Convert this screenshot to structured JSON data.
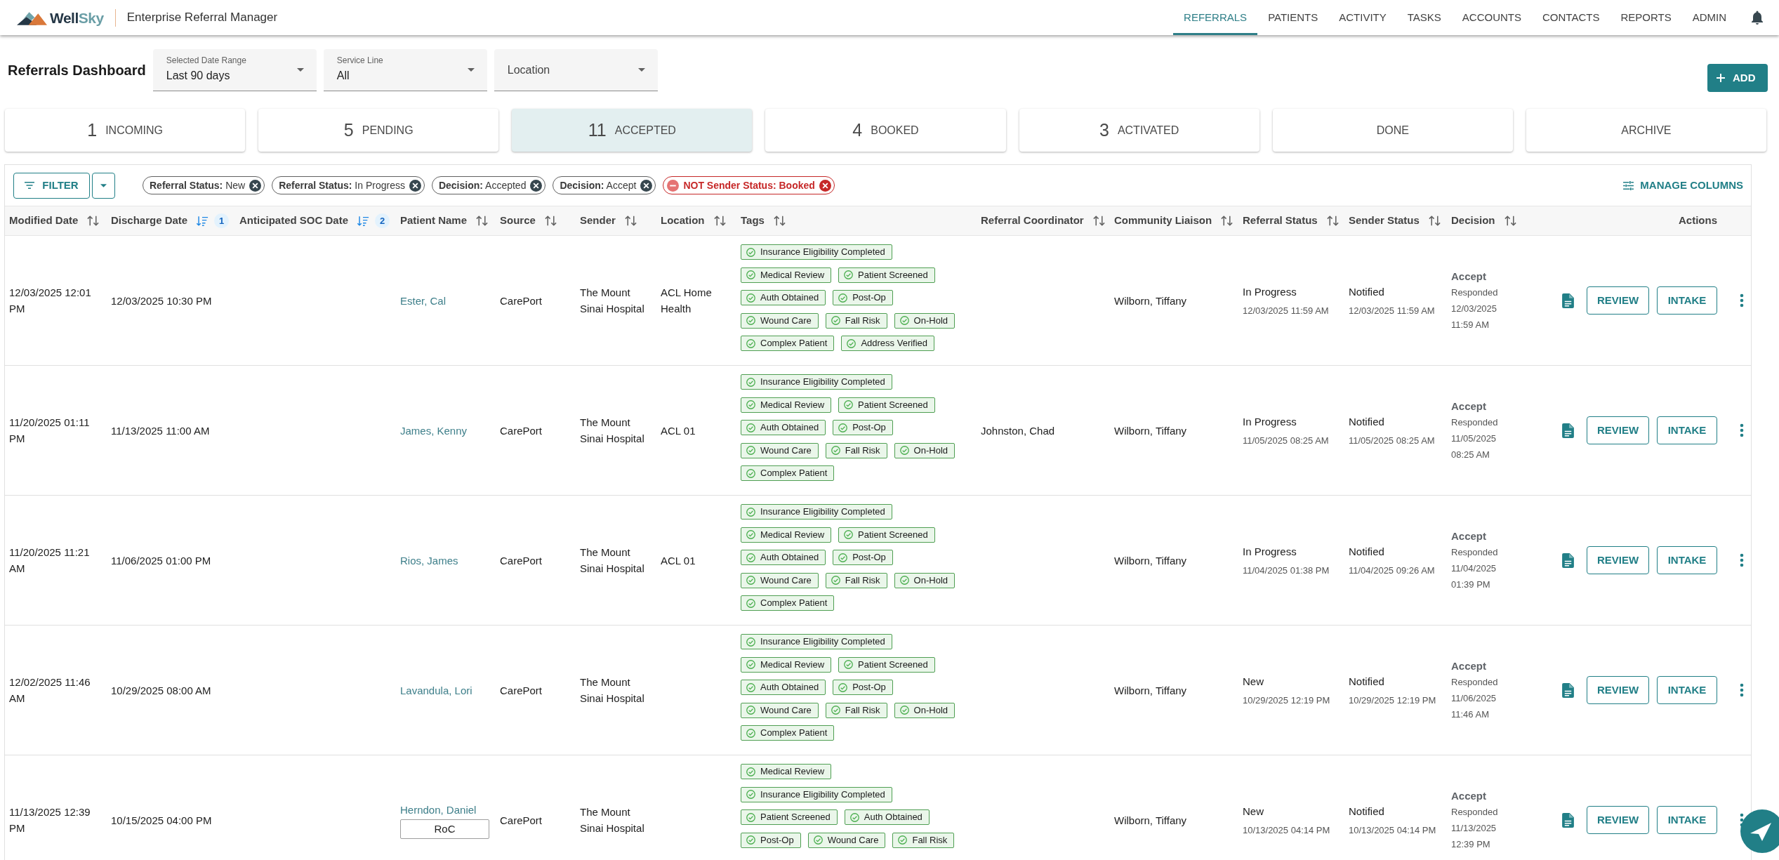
{
  "header": {
    "brand": {
      "first": "Well",
      "second": "Sky"
    },
    "app_title": "Enterprise Referral Manager",
    "nav": [
      {
        "label": "REFERRALS",
        "selected": true
      },
      {
        "label": "PATIENTS",
        "selected": false
      },
      {
        "label": "ACTIVITY",
        "selected": false
      },
      {
        "label": "TASKS",
        "selected": false
      },
      {
        "label": "ACCOUNTS",
        "selected": false
      },
      {
        "label": "CONTACTS",
        "selected": false
      },
      {
        "label": "REPORTS",
        "selected": false
      },
      {
        "label": "ADMIN",
        "selected": false
      }
    ]
  },
  "dashboard": {
    "title": "Referrals Dashboard",
    "filters": [
      {
        "label": "Selected Date Range",
        "value": "Last 90 days"
      },
      {
        "label": "Service Line",
        "value": "All"
      },
      {
        "label": "Location"
      }
    ],
    "add_button": "ADD"
  },
  "status_tabs": [
    {
      "count": "1",
      "label": "INCOMING",
      "selected": false
    },
    {
      "count": "5",
      "label": "PENDING",
      "selected": false
    },
    {
      "count": "11",
      "label": "ACCEPTED",
      "selected": true
    },
    {
      "count": "4",
      "label": "BOOKED",
      "selected": false
    },
    {
      "count": "3",
      "label": "ACTIVATED",
      "selected": false
    },
    {
      "label": "DONE",
      "selected": false
    },
    {
      "label": "ARCHIVE",
      "selected": false
    }
  ],
  "table": {
    "filter_button": "FILTER",
    "chips": [
      {
        "label": "**Referral Status:** New",
        "negated": false
      },
      {
        "label": "**Referral Status:** In Progress",
        "negated": false
      },
      {
        "label": "**Decision:** Accepted",
        "negated": false
      },
      {
        "label": "**Decision:** Accept",
        "negated": false
      },
      {
        "label": "NOT Sender Status: Booked",
        "negated": true
      }
    ],
    "manage_columns": "MANAGE COLUMNS",
    "columns": [
      {
        "label": "Modified Date",
        "sorted": false
      },
      {
        "label": "Discharge Date",
        "sorted": true,
        "sort_rank": "1"
      },
      {
        "label": "Anticipated SOC Date",
        "sorted": true,
        "sort_rank": "2"
      },
      {
        "label": "Patient Name",
        "sorted": false
      },
      {
        "label": "Source",
        "sorted": false
      },
      {
        "label": "Sender",
        "sorted": false
      },
      {
        "label": "Location",
        "sorted": false
      },
      {
        "label": "Tags",
        "sorted": false
      },
      {
        "label": "Referral Coordinator",
        "sorted": false
      },
      {
        "label": "Community Liaison",
        "sorted": false
      },
      {
        "label": "Referral Status",
        "sorted": false
      },
      {
        "label": "Sender Status",
        "sorted": false
      },
      {
        "label": "Decision",
        "sorted": false
      },
      {
        "label": "Actions"
      }
    ],
    "rows": [
      {
        "modified": "12/03/2025 12:01 PM",
        "discharge": "12/03/2025 10:30 PM",
        "patient": "Ester, Cal",
        "source": "CarePort",
        "sender": "The Mount Sinai Hospital",
        "location": "ACL Home Health",
        "tags": [
          "Insurance Eligibility Completed",
          "Medical Review",
          "Patient Screened",
          "Auth Obtained",
          "Post-Op",
          "Wound Care",
          "Fall Risk",
          "On-Hold",
          "Complex Patient",
          "Address Verified"
        ],
        "community_liaison": "Wilborn, Tiffany",
        "referral_status": {
          "status": "In Progress",
          "time": "12/03/2025 11:59 AM"
        },
        "sender_status": {
          "status": "Notified",
          "time": "12/03/2025 11:59 AM"
        },
        "decision": {
          "value": "Accept",
          "detail": "Responded 12/03/2025 11:59 AM"
        },
        "actions": [
          "REVIEW",
          "INTAKE"
        ]
      },
      {
        "modified": "11/20/2025 01:11 PM",
        "discharge": "11/13/2025 11:00 AM",
        "patient": "James, Kenny",
        "source": "CarePort",
        "sender": "The Mount Sinai Hospital",
        "location": "ACL 01",
        "tags": [
          "Insurance Eligibility Completed",
          "Medical Review",
          "Patient Screened",
          "Auth Obtained",
          "Post-Op",
          "Wound Care",
          "Fall Risk",
          "On-Hold",
          "Complex Patient"
        ],
        "referral_coordinator": "Johnston, Chad",
        "community_liaison": "Wilborn, Tiffany",
        "referral_status": {
          "status": "In Progress",
          "time": "11/05/2025 08:25 AM"
        },
        "sender_status": {
          "status": "Notified",
          "time": "11/05/2025 08:25 AM"
        },
        "decision": {
          "value": "Accept",
          "detail": "Responded 11/05/2025 08:25 AM"
        },
        "actions": [
          "REVIEW",
          "INTAKE"
        ]
      },
      {
        "modified": "11/20/2025 11:21 AM",
        "discharge": "11/06/2025 01:00 PM",
        "patient": "Rios, James",
        "source": "CarePort",
        "sender": "The Mount Sinai Hospital",
        "location": "ACL 01",
        "tags": [
          "Insurance Eligibility Completed",
          "Medical Review",
          "Patient Screened",
          "Auth Obtained",
          "Post-Op",
          "Wound Care",
          "Fall Risk",
          "On-Hold",
          "Complex Patient"
        ],
        "community_liaison": "Wilborn, Tiffany",
        "referral_status": {
          "status": "In Progress",
          "time": "11/04/2025 01:38 PM"
        },
        "sender_status": {
          "status": "Notified",
          "time": "11/04/2025 09:26 AM"
        },
        "decision": {
          "value": "Accept",
          "detail": "Responded 11/04/2025 01:39 PM"
        },
        "actions": [
          "REVIEW",
          "INTAKE"
        ]
      },
      {
        "modified": "12/02/2025 11:46 AM",
        "discharge": "10/29/2025 08:00 AM",
        "patient": "Lavandula, Lori",
        "source": "CarePort",
        "sender": "The Mount Sinai Hospital",
        "tags": [
          "Insurance Eligibility Completed",
          "Medical Review",
          "Patient Screened",
          "Auth Obtained",
          "Post-Op",
          "Wound Care",
          "Fall Risk",
          "On-Hold",
          "Complex Patient"
        ],
        "community_liaison": "Wilborn, Tiffany",
        "referral_status": {
          "status": "New",
          "time": "10/29/2025 12:19 PM"
        },
        "sender_status": {
          "status": "Notified",
          "time": "10/29/2025 12:19 PM"
        },
        "decision": {
          "value": "Accept",
          "detail": "Responded 11/06/2025 11:46 AM"
        },
        "actions": [
          "REVIEW",
          "INTAKE"
        ]
      },
      {
        "modified": "11/13/2025 12:39 PM",
        "discharge": "10/15/2025 04:00 PM",
        "patient": "Herndon, Daniel",
        "patient_tag": "RoC",
        "source": "CarePort",
        "sender": "The Mount Sinai Hospital",
        "tags": [
          "Medical Review",
          "Insurance Eligibility Completed",
          "Patient Screened",
          "Auth Obtained",
          "Post-Op",
          "Wound Care",
          "Fall Risk"
        ],
        "community_liaison": "Wilborn, Tiffany",
        "referral_status": {
          "status": "New",
          "time": "10/13/2025 04:14 PM"
        },
        "sender_status": {
          "status": "Notified",
          "time": "10/13/2025 04:14 PM"
        },
        "decision": {
          "value": "Accept",
          "detail": "Responded 11/13/2025 12:39 PM"
        },
        "actions": [
          "REVIEW",
          "INTAKE"
        ]
      }
    ]
  }
}
